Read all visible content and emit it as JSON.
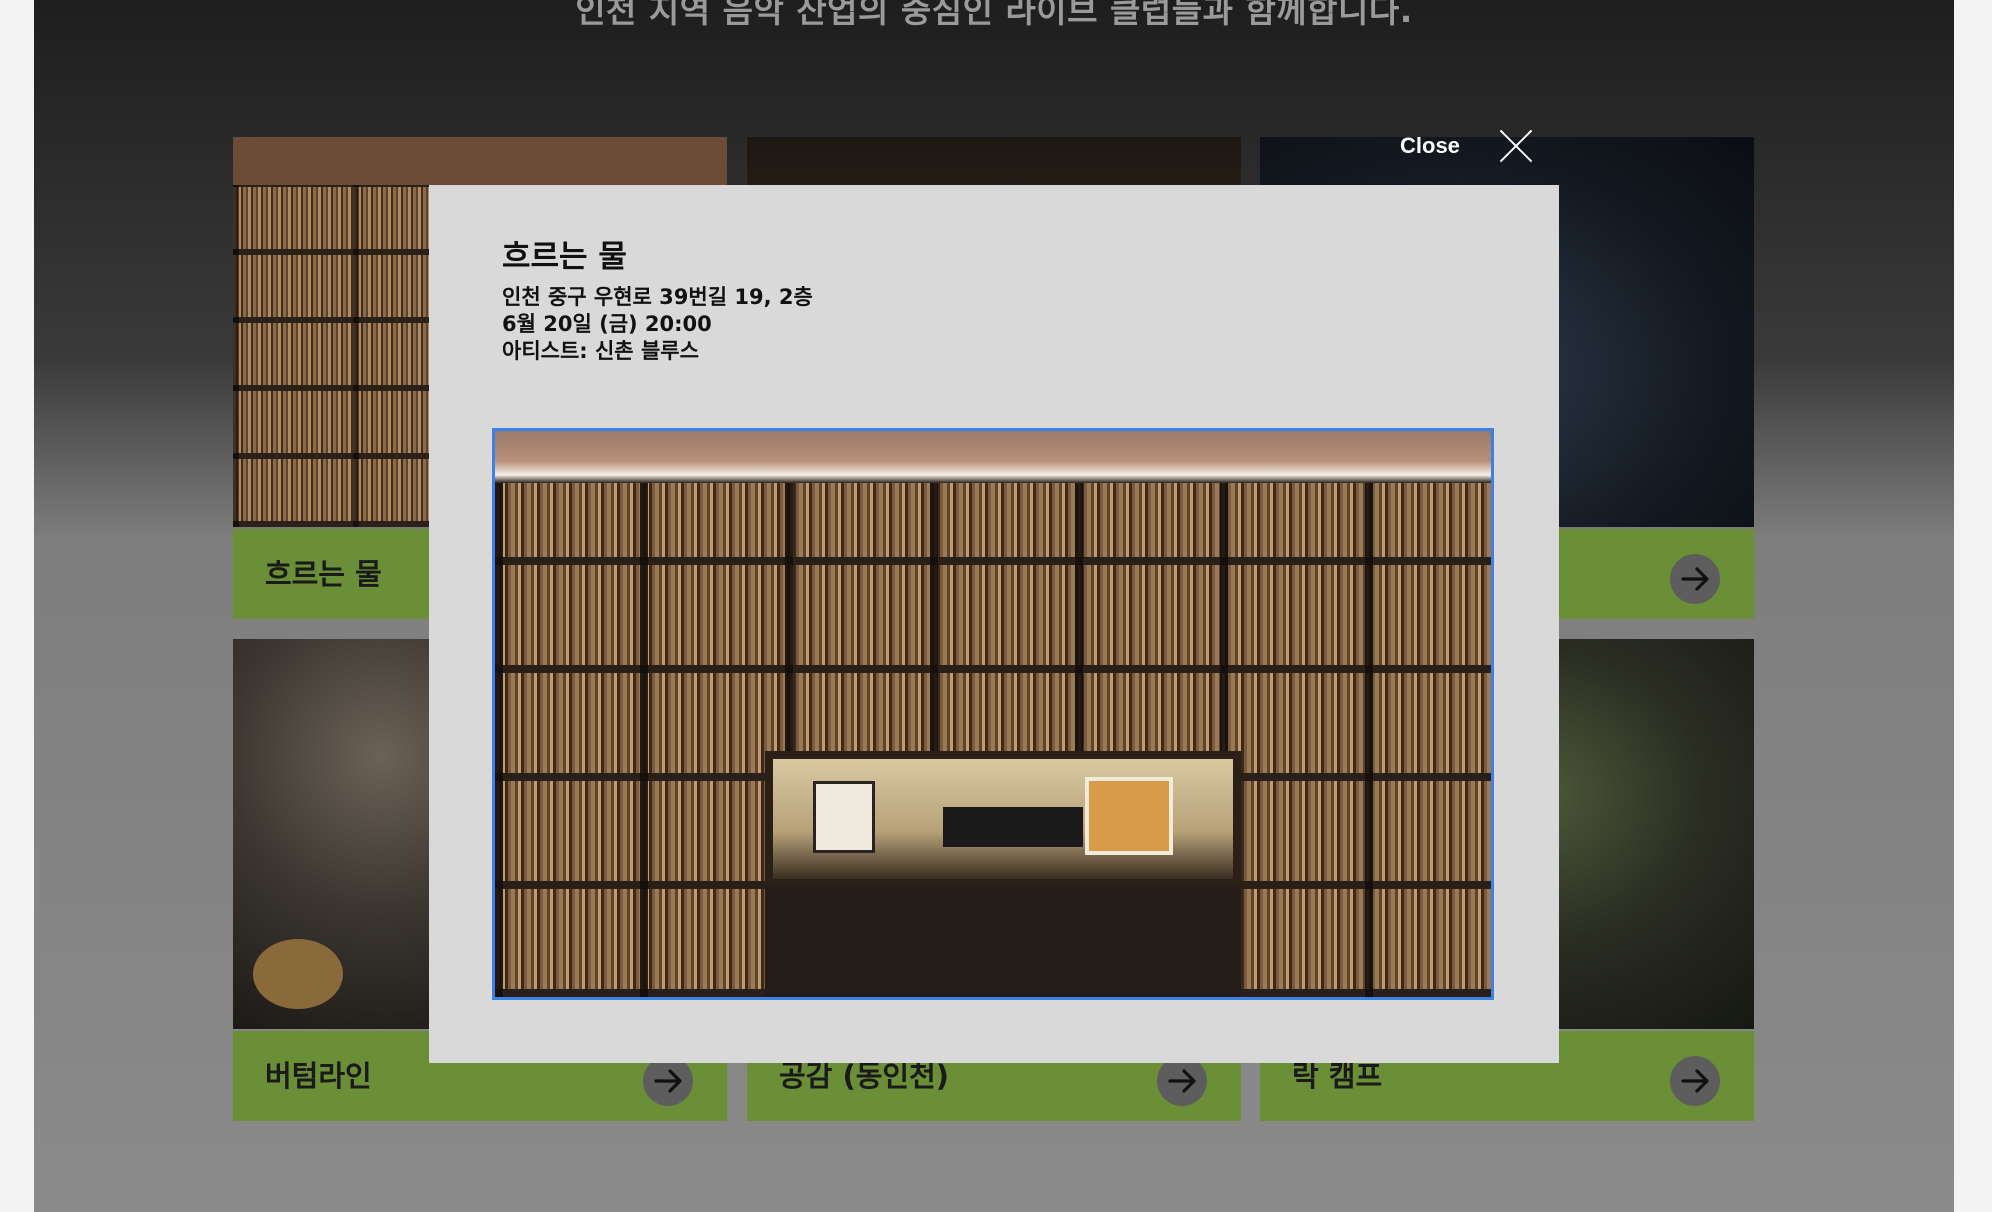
{
  "page": {
    "intro_text": "인천 지역 음악 산업의 중심인 라이브 클럽들과 함께합니다."
  },
  "cards": [
    {
      "name": "흐르는 물"
    },
    {
      "name": ""
    },
    {
      "name": ""
    },
    {
      "name": "버텀라인"
    },
    {
      "name": "공감 (동인천)"
    },
    {
      "name": "락 캠프"
    }
  ],
  "modal": {
    "close_label": "Close",
    "title": "흐르는 물",
    "address": "인천 중구 우현로 39번길 19, 2층",
    "datetime": "6월 20일 (금) 20:00",
    "artist": "아티스트: 신촌 블루스",
    "accent_color": "#3c82e6"
  },
  "colors": {
    "card_bar": "#6a8f37",
    "modal_bg": "#d9d9d9"
  },
  "icons": {
    "card_arrow": "arrow-right-icon",
    "close": "close-icon"
  }
}
